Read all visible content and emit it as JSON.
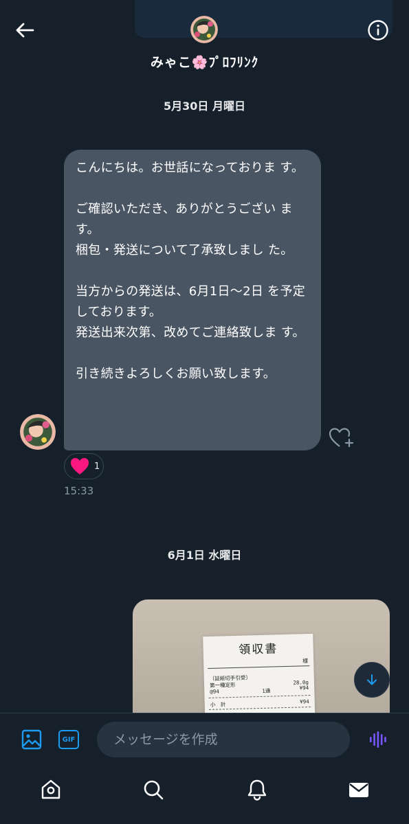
{
  "conversation": {
    "contact_name": "みゃこ🌸ﾌﾟﾛﾌﾘﾝｸ",
    "avatar_icon": "avatar-icon"
  },
  "messages": {
    "date_1": "5月30日 月曜日",
    "bubble_lines": [
      "こんにちは。お世話になっておりま す。",
      "",
      "ご確認いただき、ありがとうござい ます。",
      "梱包・発送について了承致しまし た。",
      "",
      "当方からの発送は、6月1日〜2日 を予定しております。",
      "発送出来次第、改めてご連絡致しま す。",
      "",
      "引き続きよろしくお願い致します。"
    ],
    "reaction": {
      "emoji": "heart",
      "count": "1",
      "color": "#f91880"
    },
    "time": "15:33",
    "date_2": "6月1日 水曜日"
  },
  "receipt_photo": {
    "title": "領収書",
    "sama": "様",
    "item_header": "〔証紙切手引受〕",
    "item_name": "第一種定形",
    "item_weight": "28.0g",
    "item_unit": "@94",
    "item_qty": "1通",
    "item_price": "¥94",
    "subtotal_label": "小　計",
    "subtotal_value": "¥94"
  },
  "composer": {
    "placeholder": "メッセージを作成",
    "gif_label": "GIF"
  },
  "colors": {
    "background": "#15202b",
    "bubble": "#4a5563",
    "accent": "#1d9bf0",
    "voice": "#7856ff"
  },
  "icons": {
    "back": "arrow-left-icon",
    "info": "info-icon",
    "image": "image-icon",
    "gif": "gif-icon",
    "voice": "voice-wave-icon",
    "home": "home-icon",
    "search": "search-icon",
    "notifications": "bell-icon",
    "messages": "mail-icon"
  }
}
